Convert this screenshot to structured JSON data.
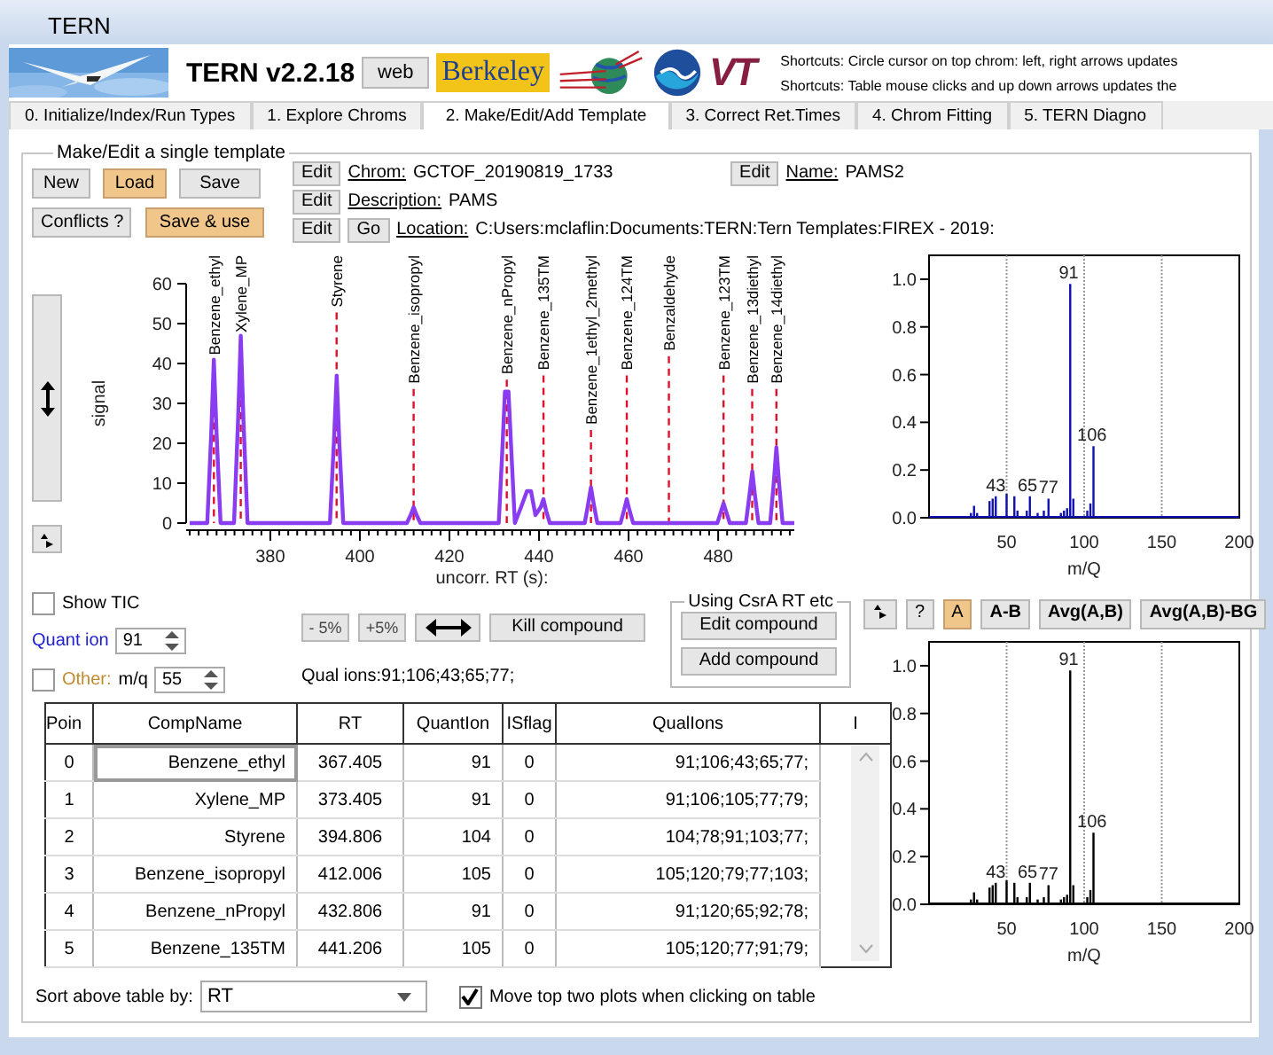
{
  "window": {
    "title": "TERN"
  },
  "header": {
    "picture": {
      "kind": "picture"
    },
    "app_name": "TERN v2.2.18",
    "web_button": "web",
    "logo_texts": [
      "Berkeley",
      "VT"
    ],
    "shortcuts": [
      "Shortcuts: Circle cursor on top chrom: left, right arrows updates",
      "Shortcuts: Table mouse clicks and up down arrows updates the"
    ]
  },
  "tabs": [
    {
      "label": "0. Initialize/Index/Run Types",
      "selected": false
    },
    {
      "label": "1. Explore Chroms",
      "selected": false
    },
    {
      "label": "2. Make/Edit/Add Template",
      "selected": true
    },
    {
      "label": "3. Correct Ret.Times",
      "selected": false
    },
    {
      "label": "4. Chrom Fitting",
      "selected": false
    },
    {
      "label": "5. TERN Diagno",
      "selected": false
    }
  ],
  "template_group": {
    "title": "Make/Edit a single template",
    "buttons": [
      {
        "label": "New",
        "highlighted": false
      },
      {
        "label": "Load",
        "highlighted": true
      },
      {
        "label": "Save",
        "highlighted": false
      },
      {
        "label": "Conflicts ?",
        "highlighted": false
      },
      {
        "label": "Save & use",
        "highlighted": true
      }
    ],
    "fields": [
      {
        "edit": "Edit",
        "label": "Chrom:",
        "value": "GCTOF_20190819_1733"
      },
      {
        "edit": "Edit",
        "label": "Description:",
        "value": "PAMS"
      },
      {
        "edit": "Edit",
        "go": "Go",
        "label": "Location:",
        "value": "C:Users:mclaflin:Documents:TERN:Tern Templates:FIREX - 2019:"
      }
    ],
    "name_field": {
      "edit": "Edit",
      "label": "Name:",
      "value": "PAMS2"
    }
  },
  "chromatogram": {
    "chart_data": {
      "type": "line",
      "xlabel": "uncorr. RT (s):",
      "ylabel": "signal",
      "xlim": [
        362,
        497
      ],
      "ylim": [
        0,
        60
      ],
      "xticks": [
        380,
        400,
        420,
        440,
        460,
        480
      ],
      "yticks": [
        0,
        10,
        20,
        30,
        40,
        50,
        60
      ],
      "x": [
        362,
        365.9,
        366.8,
        367.4,
        368.0,
        368.9,
        371.9,
        372.8,
        373.4,
        374.0,
        374.9,
        393.3,
        394.2,
        394.8,
        395.4,
        396.3,
        410.5,
        411.4,
        412.0,
        412.6,
        413.5,
        431.0,
        431.8,
        432.4,
        433.2,
        433.8,
        434.6,
        436.0,
        437.3,
        438.2,
        439.2,
        440.4,
        441.0,
        441.6,
        442.4,
        450.2,
        451.0,
        451.6,
        452.2,
        453.0,
        458.2,
        459.0,
        459.6,
        460.2,
        461.0,
        479.8,
        480.6,
        481.2,
        481.8,
        482.6,
        486.2,
        487.0,
        487.6,
        488.2,
        489.0,
        491.6,
        492.4,
        493.0,
        493.6,
        494.4,
        497
      ],
      "series": [
        {
          "color": "#8a3cf0",
          "values": [
            0,
            0,
            22,
            41,
            22,
            0,
            0,
            26,
            47,
            26,
            0,
            0,
            20,
            37,
            20,
            0,
            0,
            2.2,
            4,
            2.2,
            0,
            0,
            18,
            33,
            33,
            18,
            0,
            4,
            8,
            8,
            2,
            4,
            6,
            3,
            0,
            0,
            5,
            9,
            5,
            0,
            0,
            3.3,
            6,
            3.3,
            0,
            0,
            2.8,
            5,
            2.8,
            0,
            0,
            7,
            13,
            7,
            0,
            0,
            10,
            19,
            10,
            0,
            0
          ]
        }
      ],
      "ref_lines": [
        {
          "axis": "x",
          "value": 367.4,
          "label": "Benzene_ethyl"
        },
        {
          "axis": "x",
          "value": 373.4,
          "label": "Xylene_MP"
        },
        {
          "axis": "x",
          "value": 394.8,
          "label": "Styrene"
        },
        {
          "axis": "x",
          "value": 412.0,
          "label": "Benzene_isopropyl"
        },
        {
          "axis": "x",
          "value": 432.8,
          "label": "Benzene_nPropyl"
        },
        {
          "axis": "x",
          "value": 441.0,
          "label": "Benzene_135TM"
        },
        {
          "axis": "x",
          "value": 451.6,
          "label": "Benzene_1ethyl_2methyl"
        },
        {
          "axis": "x",
          "value": 459.6,
          "label": "Benzene_124TM"
        },
        {
          "axis": "x",
          "value": 469.0,
          "label": "Benzaldehyde"
        },
        {
          "axis": "x",
          "value": 481.2,
          "label": "Benzene_123TM"
        },
        {
          "axis": "x",
          "value": 487.6,
          "label": "Benzene_13diethyl"
        },
        {
          "axis": "x",
          "value": 493.0,
          "label": "Benzene_14diethyl"
        }
      ]
    }
  },
  "controls": {
    "show_tic": {
      "label": "Show TIC",
      "checked": false
    },
    "quant_ion": {
      "label": "Quant ion",
      "value": "91"
    },
    "other": {
      "label": "Other:",
      "checked": false,
      "mq_label": "m/q",
      "value": "55"
    },
    "shift_buttons": [
      "- 5%",
      "+5%"
    ],
    "kill_button": "Kill compound",
    "qual_ions": "Qual ions:91;106;43;65;77;",
    "csr_group": {
      "title": "Using CsrA RT etc",
      "buttons": [
        "Edit compound",
        "Add compound"
      ]
    }
  },
  "table": {
    "columns": [
      "Poin",
      "CompName",
      "RT",
      "QuantIon",
      "ISflag",
      "QualIons",
      "I"
    ],
    "rows": [
      {
        "cells": [
          "0",
          "Benzene_ethyl",
          "367.405",
          "91",
          "0",
          "91;106;43;65;77;"
        ],
        "selected": true
      },
      {
        "cells": [
          "1",
          "Xylene_MP",
          "373.405",
          "91",
          "0",
          "91;106;105;77;79;"
        ],
        "selected": false
      },
      {
        "cells": [
          "2",
          "Styrene",
          "394.806",
          "104",
          "0",
          "104;78;91;103;77;"
        ],
        "selected": false
      },
      {
        "cells": [
          "3",
          "Benzene_isopropyl",
          "412.006",
          "105",
          "0",
          "105;120;79;77;103;"
        ],
        "selected": false
      },
      {
        "cells": [
          "4",
          "Benzene_nPropyl",
          "432.806",
          "91",
          "0",
          "91;120;65;92;78;"
        ],
        "selected": false
      },
      {
        "cells": [
          "5",
          "Benzene_135TM",
          "441.206",
          "105",
          "0",
          "105;120;77;91;79;"
        ],
        "selected": false
      }
    ]
  },
  "sort": {
    "label": "Sort above table by:",
    "value": "RT"
  },
  "move_plots": {
    "label": "Move top two plots when clicking on table",
    "checked": true
  },
  "spectrum_top": {
    "chart_data": {
      "type": "bar",
      "xlabel": "m/Q",
      "xlim": [
        0,
        200
      ],
      "ylim": [
        0,
        1.1
      ],
      "grid": true,
      "xticks": [
        50,
        100,
        150,
        200
      ],
      "yticks": [
        {
          "value": 0,
          "label": "0.0"
        },
        {
          "value": 0.2,
          "label": "0.2"
        },
        {
          "value": 0.4,
          "label": "0.4"
        },
        {
          "value": 0.6,
          "label": "0.6"
        },
        {
          "value": 0.8,
          "label": "0.8"
        },
        {
          "value": 1,
          "label": "1.0"
        }
      ],
      "x": [
        27,
        29,
        31,
        39,
        41,
        43,
        50,
        55,
        57,
        63,
        65,
        70,
        74,
        77,
        85,
        87,
        89,
        91,
        93,
        102,
        104,
        106
      ],
      "series": [
        {
          "color": "#1010b0",
          "values": [
            0.02,
            0.05,
            0.02,
            0.07,
            0.08,
            0.09,
            0.1,
            0.09,
            0.03,
            0.03,
            0.09,
            0.02,
            0.03,
            0.08,
            0.02,
            0.03,
            0.04,
            0.98,
            0.08,
            0.03,
            0.06,
            0.3
          ]
        }
      ],
      "annotations": [
        {
          "x": 43,
          "y": 0.09,
          "text": "43"
        },
        {
          "x": 63.5,
          "y": 0.09,
          "text": "65"
        },
        {
          "x": 77,
          "y": 0.08,
          "text": "77"
        },
        {
          "x": 90,
          "y": 0.98,
          "text": "91"
        },
        {
          "x": 105,
          "y": 0.3,
          "text": "106"
        }
      ]
    }
  },
  "spectrum_buttons": [
    {
      "label": "?",
      "selected": false
    },
    {
      "label": "A",
      "selected": true
    },
    {
      "label": "A-B",
      "selected": false
    },
    {
      "label": "Avg(A,B)",
      "selected": false
    },
    {
      "label": "Avg(A,B)-BG",
      "selected": false
    }
  ],
  "spectrum_bottom": {
    "chart_data": {
      "type": "bar",
      "xlabel": "m/Q",
      "xlim": [
        0,
        200
      ],
      "ylim": [
        0,
        1.1
      ],
      "grid": true,
      "xticks": [
        50,
        100,
        150,
        200
      ],
      "yticks": [
        {
          "value": 0,
          "label": "0.0"
        },
        {
          "value": 0.2,
          "label": "0.2"
        },
        {
          "value": 0.4,
          "label": "0.4"
        },
        {
          "value": 0.6,
          "label": "0.6"
        },
        {
          "value": 0.8,
          "label": "0.8"
        },
        {
          "value": 1,
          "label": "1.0"
        }
      ],
      "x": [
        27,
        29,
        31,
        39,
        41,
        43,
        50,
        55,
        57,
        63,
        65,
        70,
        74,
        77,
        85,
        87,
        89,
        91,
        93,
        102,
        104,
        106
      ],
      "series": [
        {
          "color": "#000000",
          "values": [
            0.02,
            0.05,
            0.02,
            0.07,
            0.08,
            0.09,
            0.1,
            0.09,
            0.03,
            0.03,
            0.09,
            0.02,
            0.03,
            0.08,
            0.02,
            0.03,
            0.04,
            0.98,
            0.08,
            0.03,
            0.06,
            0.3
          ]
        }
      ],
      "annotations": [
        {
          "x": 43,
          "y": 0.09,
          "text": "43"
        },
        {
          "x": 63.5,
          "y": 0.09,
          "text": "65"
        },
        {
          "x": 77,
          "y": 0.08,
          "text": "77"
        },
        {
          "x": 90,
          "y": 0.98,
          "text": "91"
        },
        {
          "x": 105,
          "y": 0.3,
          "text": "106"
        }
      ]
    }
  }
}
